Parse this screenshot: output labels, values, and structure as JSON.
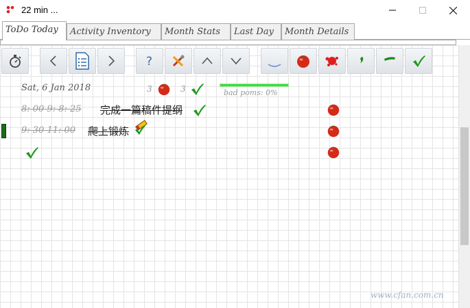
{
  "window": {
    "title": "22 min ...",
    "controls": {
      "minimize_icon": "minimize-icon",
      "maximize_icon": "maximize-icon",
      "close_icon": "close-icon"
    }
  },
  "tabs": [
    {
      "label": "ToDo Today",
      "active": true
    },
    {
      "label": "Activity Inventory",
      "active": false
    },
    {
      "label": "Month Stats",
      "active": false
    },
    {
      "label": "Last Day",
      "active": false
    },
    {
      "label": "Month Details",
      "active": false
    }
  ],
  "toolbar": [
    {
      "name": "stopwatch-button",
      "icon": "stopwatch-icon"
    },
    {
      "name": "previous-button",
      "icon": "chevron-left-icon"
    },
    {
      "name": "document-button",
      "icon": "document-list-icon"
    },
    {
      "name": "next-button",
      "icon": "chevron-right-icon"
    },
    {
      "name": "help-button",
      "icon": "question-icon"
    },
    {
      "name": "tools-button",
      "icon": "tools-icon"
    },
    {
      "name": "move-up-button",
      "icon": "chevron-up-icon"
    },
    {
      "name": "move-down-button",
      "icon": "chevron-down-icon"
    },
    {
      "name": "underline-button",
      "icon": "underline-icon"
    },
    {
      "name": "tomato-button",
      "icon": "tomato-icon"
    },
    {
      "name": "squashed-tomato-button",
      "icon": "squashed-tomato-icon"
    },
    {
      "name": "apostrophe-button",
      "icon": "apostrophe-icon"
    },
    {
      "name": "dash-button",
      "icon": "dash-icon"
    },
    {
      "name": "check-button",
      "icon": "check-icon"
    }
  ],
  "summary": {
    "date": "Sat, 6 Jan 2018",
    "tomato_count": "3",
    "done_count": "3",
    "bad_poms_label": "bad poms: 0%",
    "bad_poms_progress": 1.0
  },
  "tasks": [
    {
      "time": "8: 00 9: 8: 25",
      "title": "完成一篇稿件提纲"
    },
    {
      "time": "9: 30 11: 00",
      "title": "爬上锻炼"
    }
  ],
  "watermark": "www.cfan.com.cn",
  "colors": {
    "tomato": "#d42a1a",
    "check": "#1d9a1d",
    "progress": "#3ddc3d"
  }
}
